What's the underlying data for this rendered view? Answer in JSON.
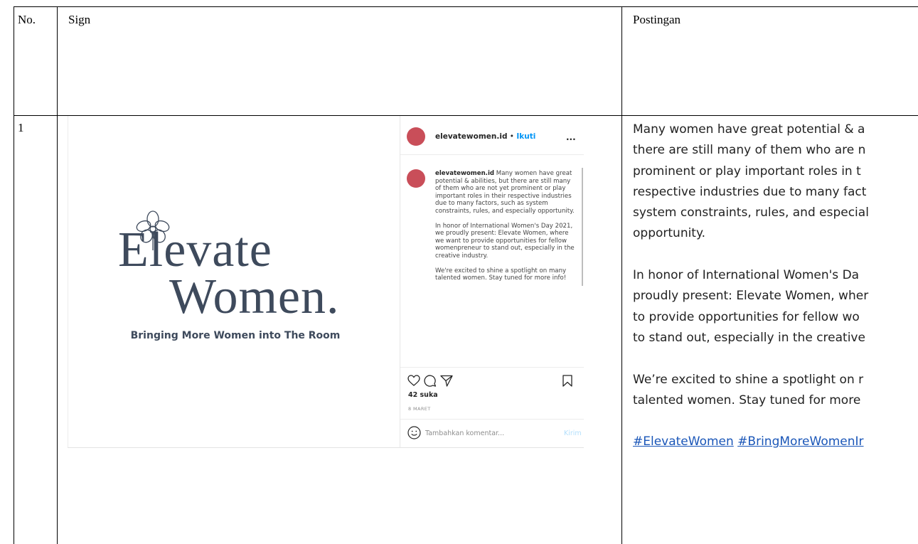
{
  "table": {
    "headers": {
      "no": "No.",
      "sign": "Sign",
      "post": "Postingan"
    },
    "row_number": "1"
  },
  "logo": {
    "line1": "Elevate",
    "line2": "Women.",
    "tagline": "Bringing More Women into The Room",
    "icon": "flower-icon",
    "color": "#3e4a5c"
  },
  "instagram": {
    "username": "elevatewomen.id",
    "separator": " • ",
    "follow_label": "Ikuti",
    "more_label": "...",
    "avatar_color": "#c94e59",
    "caption_user": "elevatewomen.id",
    "caption_paragraphs": [
      "Many women have great potential & abilities, but there are still many of them who are not yet prominent or play important roles in their respective industries due to many factors, such as system constraints, rules, and especially opportunity.",
      "In honor of International Women's Day 2021, we proudly present: Elevate Women, where we want to provide opportunities for fellow womenpreneur to stand out, especially in the creative industry.",
      "We're excited to shine a spotlight on many talented women. Stay tuned for more info!"
    ],
    "likes": "42 suka",
    "date": "8 MARET",
    "comment_placeholder": "Tambahkan komentar...",
    "send_label": "Kirim",
    "icons": [
      "heart-icon",
      "comment-icon",
      "share-icon",
      "bookmark-icon",
      "emoji-icon"
    ]
  },
  "post_text": {
    "lines_p1": [
      "Many women have great potential & a",
      "there are still many of them who are n",
      "prominent or play important roles in t",
      "respective industries due to many fact",
      "system constraints, rules, and especial",
      "opportunity."
    ],
    "lines_p2": [
      "In honor of International Women's Da",
      "proudly present: Elevate Women, wher",
      "to provide opportunities for fellow wo",
      "to stand out, especially in the creative"
    ],
    "lines_p3": [
      "We’re excited to shine a spotlight on r",
      "talented women. Stay tuned for more"
    ],
    "hashtags": [
      "#ElevateWomen",
      "#BringMoreWomenIr"
    ]
  }
}
